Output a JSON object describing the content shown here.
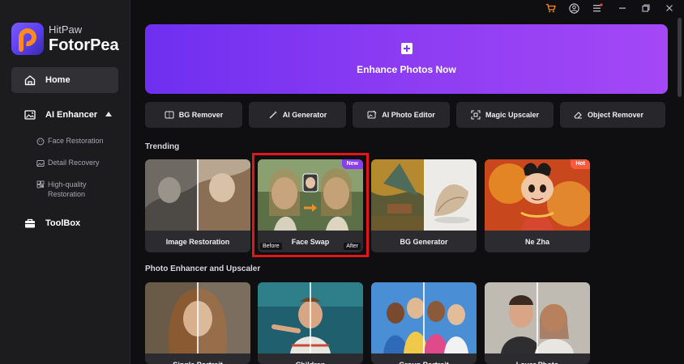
{
  "app": {
    "brand": "HitPaw",
    "name": "FotorPea"
  },
  "sidebar": {
    "home": "Home",
    "ai_enhancer": "AI Enhancer",
    "sub_items": [
      "Face Restoration",
      "Detail Recovery",
      "High-quality Restoration"
    ],
    "toolbox": "ToolBox"
  },
  "hero": {
    "label": "Enhance Photos Now"
  },
  "tools": [
    "BG Remover",
    "AI Generator",
    "AI Photo Editor",
    "Magic Upscaler",
    "Object Remover"
  ],
  "sections": {
    "trending": "Trending",
    "photo_enhancer": "Photo Enhancer and Upscaler"
  },
  "trending": [
    {
      "label": "Image Restoration"
    },
    {
      "label": "Face Swap",
      "badge": "New",
      "before": "Before",
      "after": "After"
    },
    {
      "label": "BG Generator"
    },
    {
      "label": "Ne Zha",
      "badge": "Hot"
    }
  ],
  "enhancer": [
    {
      "label": "Single Portrait"
    },
    {
      "label": "Children"
    },
    {
      "label": "Group Portrait"
    },
    {
      "label": "Lover Photo"
    }
  ],
  "colors": {
    "accent": "#8a3bf2",
    "highlight": "#e0161b",
    "hot": "#ff5a3c",
    "sidebar_bg": "#1c1c1f",
    "app_bg": "#0f0f11"
  }
}
